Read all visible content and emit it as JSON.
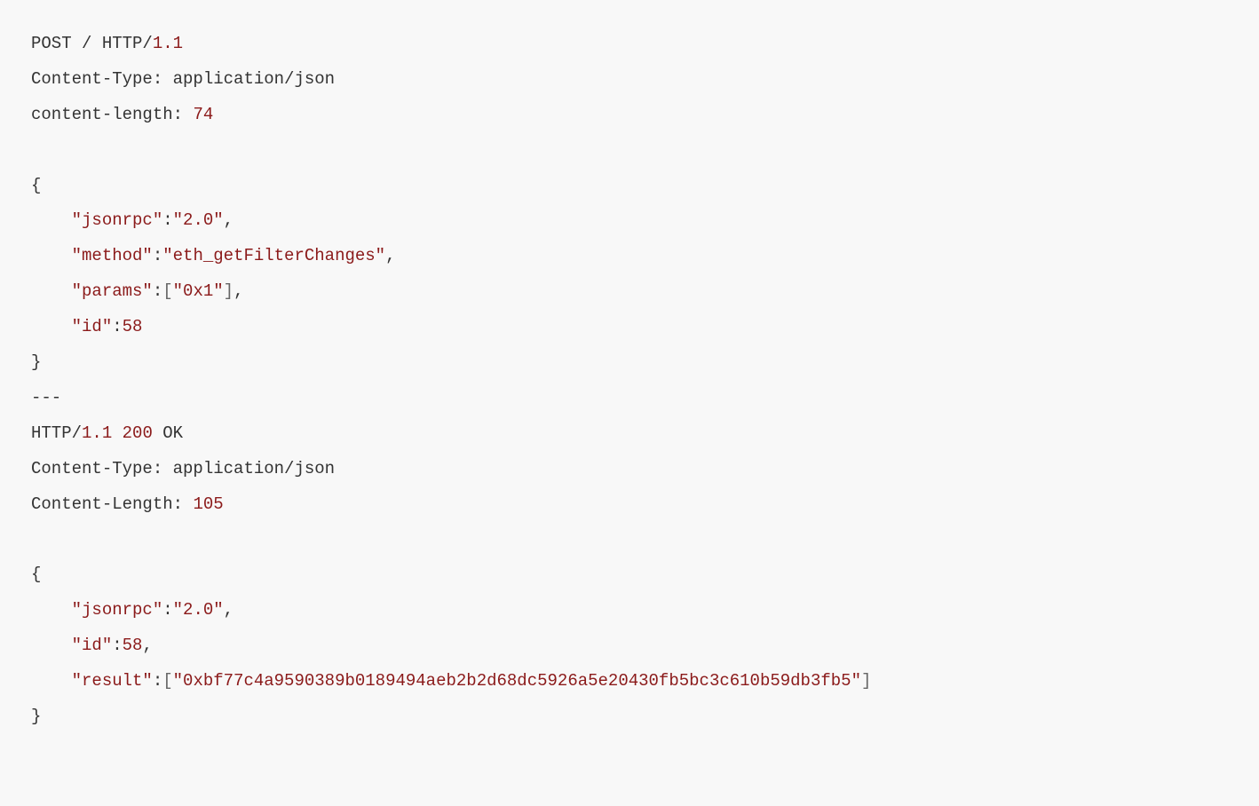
{
  "colors": {
    "background": "#f8f8f8",
    "text_plain": "#333333",
    "text_highlight": "#8b1a1a",
    "text_bracket": "#666666"
  },
  "request": {
    "line1": {
      "method": "POST",
      "path": " / HTTP/",
      "version": "1.1"
    },
    "headers": {
      "content_type_label": "Content-Type: application/json",
      "content_length_label": "content-length: ",
      "content_length_value": "74"
    },
    "body": {
      "open_brace": "{",
      "jsonrpc_key": "\"jsonrpc\"",
      "jsonrpc_val": "\"2.0\"",
      "method_key": "\"method\"",
      "method_val": "\"eth_getFilterChanges\"",
      "params_key": "\"params\"",
      "params_open": "[",
      "params_val": "\"0x1\"",
      "params_close": "]",
      "id_key": "\"id\"",
      "id_val": "58",
      "close_brace": "}"
    }
  },
  "separator": "---",
  "response": {
    "line1": {
      "protocol": "HTTP/",
      "version": "1.1",
      "status_code": "200",
      "status_text": " OK"
    },
    "headers": {
      "content_type_label": "Content-Type: application/json",
      "content_length_label": "Content-Length: ",
      "content_length_value": "105"
    },
    "body": {
      "open_brace": "{",
      "jsonrpc_key": "\"jsonrpc\"",
      "jsonrpc_val": "\"2.0\"",
      "id_key": "\"id\"",
      "id_val": "58",
      "result_key": "\"result\"",
      "result_open": "[",
      "result_val": "\"0xbf77c4a9590389b0189494aeb2b2d68dc5926a5e20430fb5bc3c610b59db3fb5\"",
      "result_close": "]",
      "close_brace": "}"
    }
  }
}
